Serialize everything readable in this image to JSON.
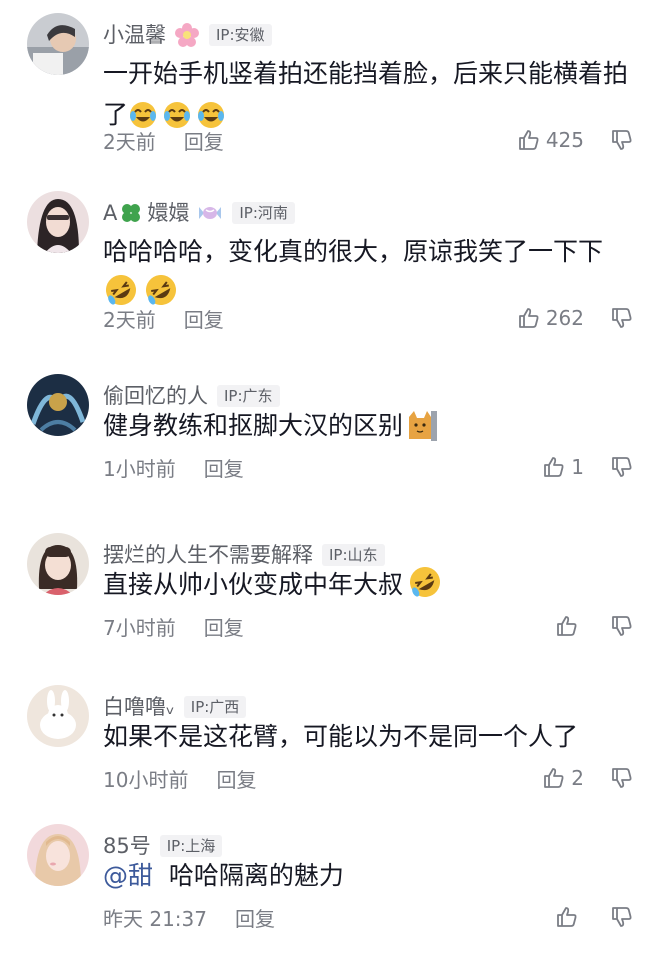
{
  "comments": [
    {
      "username": "小温馨",
      "flair": "flower",
      "ip": "IP:安徽",
      "text": "一开始手机竖着拍还能挡着脸，后来只能横着拍了",
      "emojis": [
        "tears-of-joy-emoji",
        "tears-of-joy-emoji",
        "tears-of-joy-emoji"
      ],
      "time": "2天前",
      "reply": "回复",
      "likes": "425"
    },
    {
      "username_prefix": "A",
      "username": "嬛嬛",
      "flair": "candy",
      "ip": "IP:河南",
      "text": "哈哈哈哈，变化真的很大，原谅我笑了一下下",
      "emojis": [
        "rolling-laughing-emoji",
        "rolling-laughing-emoji"
      ],
      "time": "2天前",
      "reply": "回复",
      "likes": "262"
    },
    {
      "username": "偷回忆的人",
      "ip": "IP:广东",
      "text": "健身教练和抠脚大汉的区别",
      "emojis": [
        "cat-sticker-emoji"
      ],
      "time": "1小时前",
      "reply": "回复",
      "likes": "1"
    },
    {
      "username": "摆烂的人生不需要解释",
      "ip": "IP:山东",
      "text": "直接从帅小伙变成中年大叔",
      "emojis": [
        "rolling-laughing-emoji"
      ],
      "time": "7小时前",
      "reply": "回复",
      "likes": ""
    },
    {
      "username": "白噜噜ᵥ",
      "ip": "IP:广西",
      "text": "如果不是这花臂，可能以为不是同一个人了",
      "emojis": [],
      "time": "10小时前",
      "reply": "回复",
      "likes": "2"
    },
    {
      "username": "85号",
      "ip": "IP:上海",
      "mention": "@甜",
      "text": "哈哈隔离的魅力",
      "emojis": [],
      "time": "昨天 21:37",
      "reply": "回复",
      "likes": ""
    }
  ],
  "colors": {
    "text": "#161823",
    "secondary": "#7a7d85",
    "mention": "#3d5a9b",
    "badge_bg": "#f2f2f4"
  }
}
